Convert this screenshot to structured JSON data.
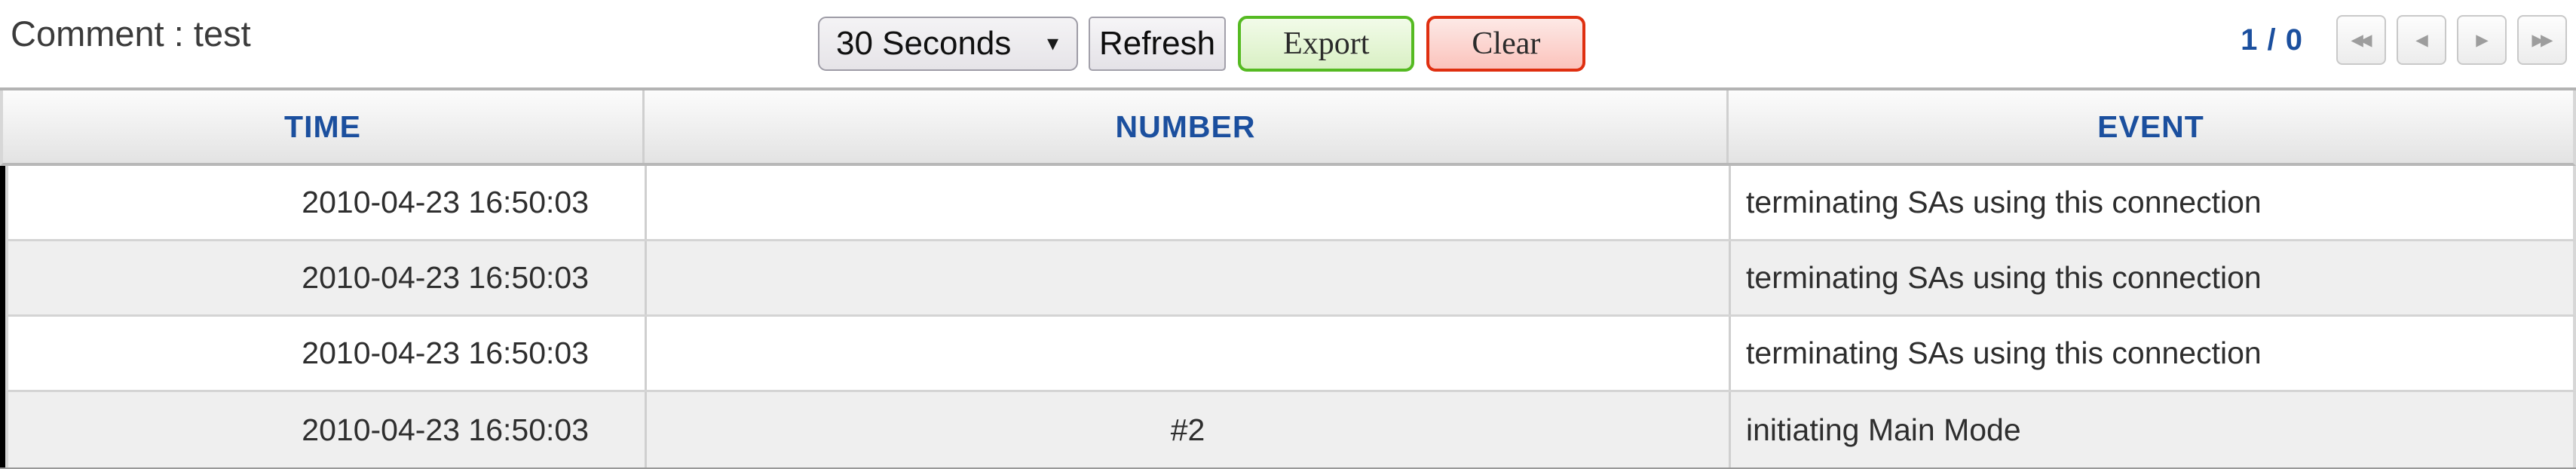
{
  "header": {
    "title": "Comment : test",
    "interval_select": {
      "value": "30 Seconds",
      "options": [
        "30 Seconds"
      ],
      "arrow": "chevron-down-icon"
    },
    "refresh_label": "Refresh",
    "export_label": "Export",
    "clear_label": "Clear",
    "colors": {
      "export_border": "#55ba22",
      "clear_border": "#df2f10",
      "header_text": "#1b4f9e"
    }
  },
  "pagination": {
    "count_label": "1 / 0",
    "current_page": 1,
    "total_pages": 0,
    "first_label": "◂◂",
    "prev_label": "◂",
    "next_label": "▸",
    "last_label": "▸▸"
  },
  "table": {
    "columns": [
      "TIME",
      "NUMBER",
      "EVENT"
    ],
    "rows": [
      {
        "time": "2010-04-23 16:50:03",
        "number": "",
        "event": "terminating SAs using this connection"
      },
      {
        "time": "2010-04-23 16:50:03",
        "number": "",
        "event": "terminating SAs using this connection"
      },
      {
        "time": "2010-04-23 16:50:03",
        "number": "",
        "event": "terminating SAs using this connection"
      },
      {
        "time": "2010-04-23 16:50:03",
        "number": "#2",
        "event": "initiating Main Mode"
      }
    ]
  }
}
